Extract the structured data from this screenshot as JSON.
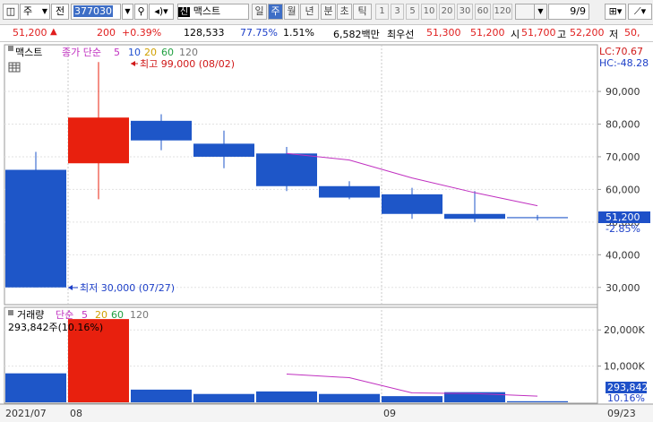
{
  "toolbar": {
    "market_label": "주",
    "prev_label": "전",
    "code": "377030",
    "name_badge": "신",
    "name": "맥스트",
    "periods": [
      "일",
      "주",
      "월",
      "년",
      "분",
      "초",
      "틱"
    ],
    "selected_period": "주",
    "intervals": [
      "1",
      "3",
      "5",
      "10",
      "20",
      "30",
      "60",
      "120"
    ],
    "page": "9/9"
  },
  "quote": {
    "price": "51,200",
    "change_arrow": "▲",
    "change": "200",
    "change_pct": "+0.39%",
    "volume": "128,533",
    "vol_ratio": "77.75%",
    "turnover_pct": "1.51%",
    "amount": "6,582백만",
    "best_label": "최우선",
    "best_ask": "51,300",
    "best_bid": "51,200",
    "open_label": "시",
    "open": "51,700",
    "high_label": "고",
    "high": "52,200",
    "low_label": "저",
    "low": "50,"
  },
  "price_panel": {
    "stock_label": "맥스트",
    "legend_type": "종가 단순",
    "ma_periods": [
      {
        "value": "5",
        "color": "#c030c0"
      },
      {
        "value": "10",
        "color": "#2050d0"
      },
      {
        "value": "20",
        "color": "#d0a000"
      },
      {
        "value": "60",
        "color": "#20a040"
      },
      {
        "value": "120",
        "color": "#777777"
      }
    ],
    "lc_label": "LC:70.67",
    "hc_label": "HC:-48.28",
    "max_annotation": "최고 99,000 (08/02)",
    "min_annotation": "최저 30,000 (07/27)",
    "last_price": "51,200",
    "last_pct": "-2.85%",
    "yticks": [
      "90,000",
      "80,000",
      "70,000",
      "60,000",
      "50,000",
      "40,000",
      "30,000"
    ]
  },
  "volume_panel": {
    "legend_label": "거래량",
    "legend_type": "단순",
    "ma_periods": [
      {
        "value": "5",
        "color": "#c030c0"
      },
      {
        "value": "20",
        "color": "#d0a000"
      },
      {
        "value": "60",
        "color": "#20a040"
      },
      {
        "value": "120",
        "color": "#777777"
      }
    ],
    "current": "293,842주(10.16%)",
    "last_volume": "293,842",
    "last_pct": "10.16%",
    "yticks": [
      "20,000K",
      "10,000K"
    ]
  },
  "xaxis": {
    "labels": [
      "2021/07",
      "08",
      "09",
      "09/23"
    ]
  },
  "chart_data": {
    "type": "candlestick",
    "candles": [
      {
        "open": 66000,
        "high": 71500,
        "low": 30000,
        "close": 30000,
        "volume": 8000
      },
      {
        "open": 68000,
        "high": 99000,
        "low": 57000,
        "close": 82000,
        "volume": 23000
      },
      {
        "open": 81000,
        "high": 83000,
        "low": 72000,
        "close": 75000,
        "volume": 3500
      },
      {
        "open": 74000,
        "high": 78000,
        "low": 66500,
        "close": 70000,
        "volume": 2300
      },
      {
        "open": 71000,
        "high": 73000,
        "low": 59500,
        "close": 61000,
        "volume": 3000
      },
      {
        "open": 61000,
        "high": 62500,
        "low": 57000,
        "close": 57500,
        "volume": 2300
      },
      {
        "open": 58500,
        "high": 60500,
        "low": 51000,
        "close": 52500,
        "volume": 1700
      },
      {
        "open": 52500,
        "high": 59500,
        "low": 50000,
        "close": 51000,
        "volume": 2800
      },
      {
        "open": 51500,
        "high": 52200,
        "low": 50500,
        "close": 51200,
        "volume": 294
      }
    ],
    "ma5_price": [
      null,
      null,
      null,
      null,
      71000,
      69000,
      63500,
      59000,
      55000
    ],
    "ma5_volume": [
      null,
      null,
      null,
      null,
      7800,
      6800,
      2600,
      2400,
      1700
    ],
    "price_ylim": [
      25000,
      104000
    ],
    "volume_ylim": [
      0,
      26000
    ]
  }
}
